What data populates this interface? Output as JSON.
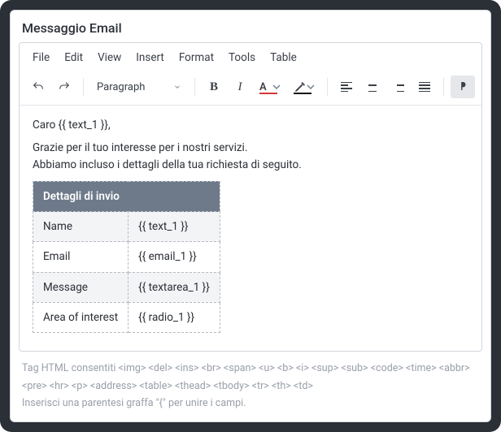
{
  "header": {
    "title": "Messaggio Email"
  },
  "menubar": [
    "File",
    "Edit",
    "View",
    "Insert",
    "Format",
    "Tools",
    "Table"
  ],
  "toolbar": {
    "block_format": "Paragraph",
    "text_color": "#d63638",
    "bg_color": "#111111"
  },
  "body": {
    "greeting": "Caro {{ text_1 }},",
    "line1": "Grazie per il tuo interesse per i nostri servizi.",
    "line2": "Abbiamo incluso i dettagli della tua richiesta di seguito.",
    "table": {
      "header": "Dettagli di invio",
      "rows": [
        {
          "k": "Name",
          "v": "{{ text_1 }}"
        },
        {
          "k": "Email",
          "v": "{{ email_1 }}"
        },
        {
          "k": "Message",
          "v": "{{ textarea_1 }}"
        },
        {
          "k": "Area of interest",
          "v": "{{ radio_1 }}"
        }
      ]
    }
  },
  "hints": {
    "allowed": "Tag HTML consentiti <img> <del> <ins> <br> <span> <u> <b> <i> <sup> <sub> <code> <time> <abbr> <pre> <hr> <p> <address> <table> <thead> <tbody> <tr> <th> <td>",
    "merge": "Inserisci una parentesi graffa \"{\" per unire i campi."
  }
}
